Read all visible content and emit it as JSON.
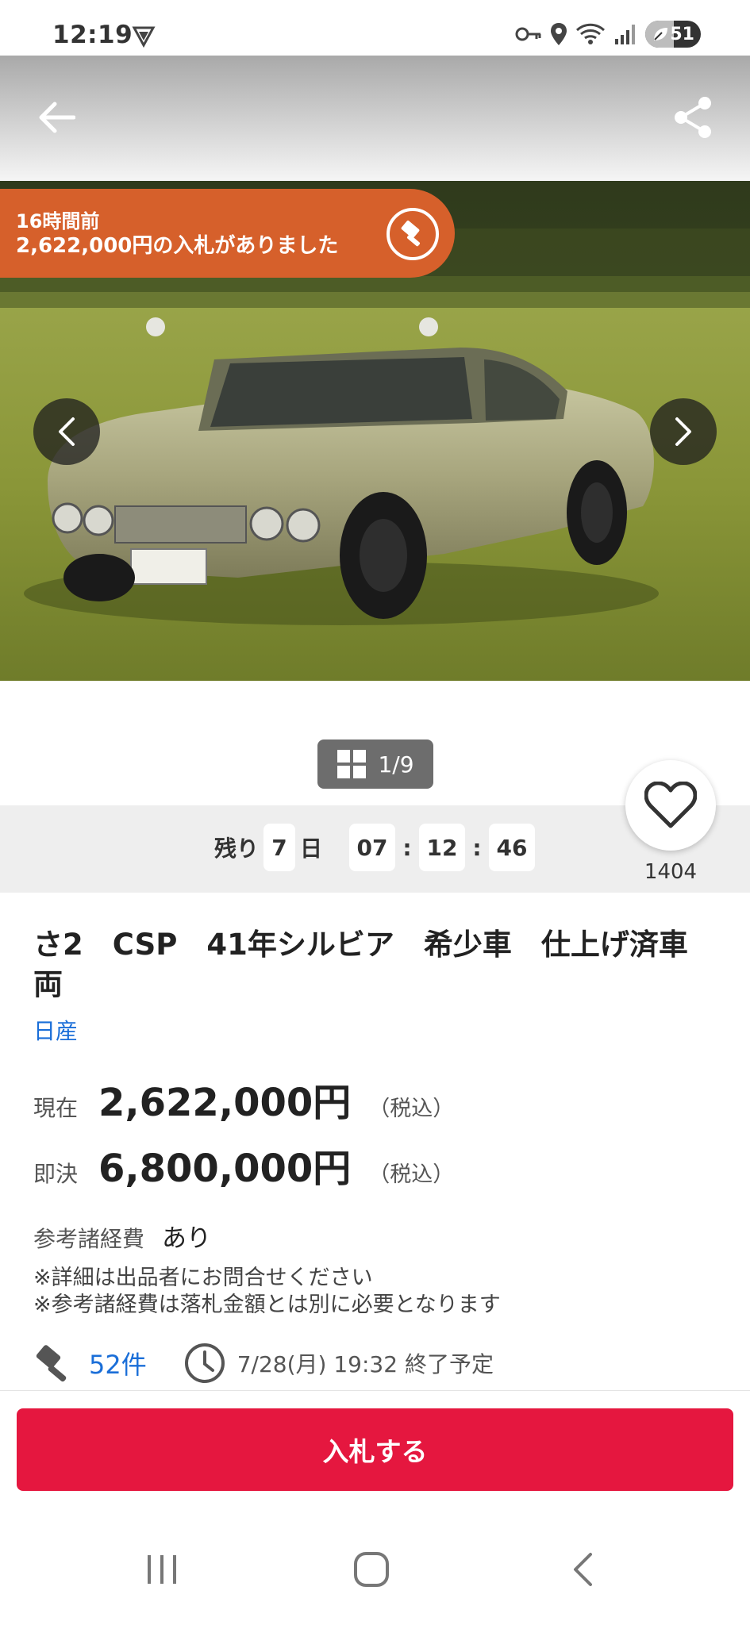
{
  "status_bar": {
    "time": "12:19",
    "battery": "51",
    "battery_level": 0.51
  },
  "header": {
    "back_icon": "arrow-left-icon",
    "share_icon": "share-icon"
  },
  "hero": {
    "bid_banner": {
      "time_ago": "16時間前",
      "message": "2,622,000円の入札がありました",
      "icon": "gavel-icon",
      "color": "#d6602b"
    },
    "pager": "1/9"
  },
  "countdown": {
    "prefix": "残り",
    "days": "7",
    "day_unit": "日",
    "hours": "07",
    "minutes": "12",
    "seconds": "46",
    "separator": ":"
  },
  "favorite": {
    "count": "1404",
    "icon": "heart-icon"
  },
  "listing": {
    "title": "さ2　CSP　41年シルビア　希少車　仕上げ済車両",
    "maker": "日産",
    "current_label": "現在",
    "current_price": "2,622,000円",
    "buynow_label": "即決",
    "buynow_price": "6,800,000円",
    "tax_note": "（税込）",
    "fee_label": "参考諸経費",
    "fee_value": "あり",
    "note1": "※詳細は出品者にお問合せください",
    "note2": "※参考諸経費は落札金額とは別に必要となります",
    "bid_count": "52件",
    "end_time": "7/28(月) 19:32 終了予定"
  },
  "actions": {
    "bid_button": "入札する",
    "accent": "#e5173f"
  },
  "colors": {
    "link": "#1a6ed8"
  }
}
